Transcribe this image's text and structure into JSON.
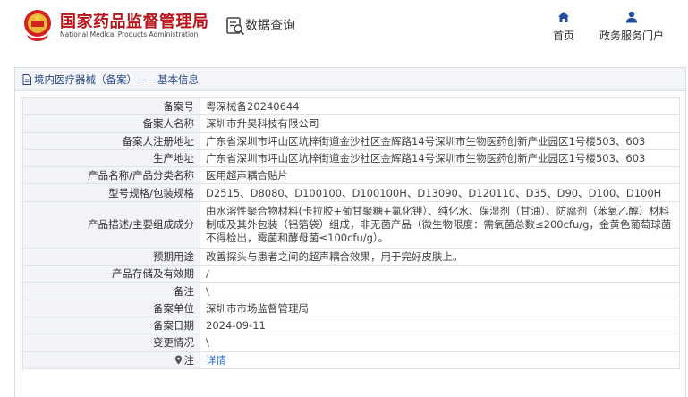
{
  "header": {
    "site_name": "国家药品监督管理局",
    "site_name_en": "National Medical Products Administration",
    "query_label": "数据查询",
    "nav": [
      {
        "label": "首页",
        "icon": "home-icon"
      },
      {
        "label": "政务服务门户",
        "icon": "user-icon"
      }
    ]
  },
  "panel": {
    "title": "境内医疗器械（备案）——基本信息"
  },
  "rows": [
    {
      "label": "备案号",
      "value": "粤深械备20240644"
    },
    {
      "label": "备案人名称",
      "value": "深圳市升昊科技有限公司"
    },
    {
      "label": "备案人注册地址",
      "value": "广东省深圳市坪山区坑梓街道金沙社区金辉路14号深圳市生物医药创新产业园区1号楼503、603"
    },
    {
      "label": "生产地址",
      "value": "广东省深圳市坪山区坑梓街道金沙社区金辉路14号深圳市生物医药创新产业园区1号楼503、603"
    },
    {
      "label": "产品名称/产品分类名称",
      "value": "医用超声耦合贴片"
    },
    {
      "label": "型号规格/包装规格",
      "value": "D2515、D8080、D100100、D100100H、D13090、D120110、D35、D90、D100、D100H"
    },
    {
      "label": "产品描述/主要组成成分",
      "value": "由水溶性聚合物材料(卡拉胶+葡甘聚糖+氯化钾）、纯化水、保湿剂（甘油）、防腐剂（苯氧乙醇）材料制成及其外包装（铝箔袋）组成，非无菌产品（微生物限度：需氧菌总数≤200cfu/g，金黄色葡萄球菌不得检出，霉菌和酵母菌≤100cfu/g）。"
    },
    {
      "label": "预期用途",
      "value": "改善探头与患者之间的超声耦合效果，用于完好皮肤上。"
    },
    {
      "label": "产品存储及有效期",
      "value": "/"
    },
    {
      "label": "备注",
      "value": "\\"
    },
    {
      "label": "备案单位",
      "value": "深圳市市场监督管理局"
    },
    {
      "label": "备案日期",
      "value": "2024-09-11"
    },
    {
      "label": "变更情况",
      "value": "\\"
    },
    {
      "label": "注",
      "value": "详情"
    }
  ],
  "colors": {
    "brand_red": "#b8141a",
    "link_blue": "#2a6bc2",
    "title_blue": "#2b4a8a"
  }
}
